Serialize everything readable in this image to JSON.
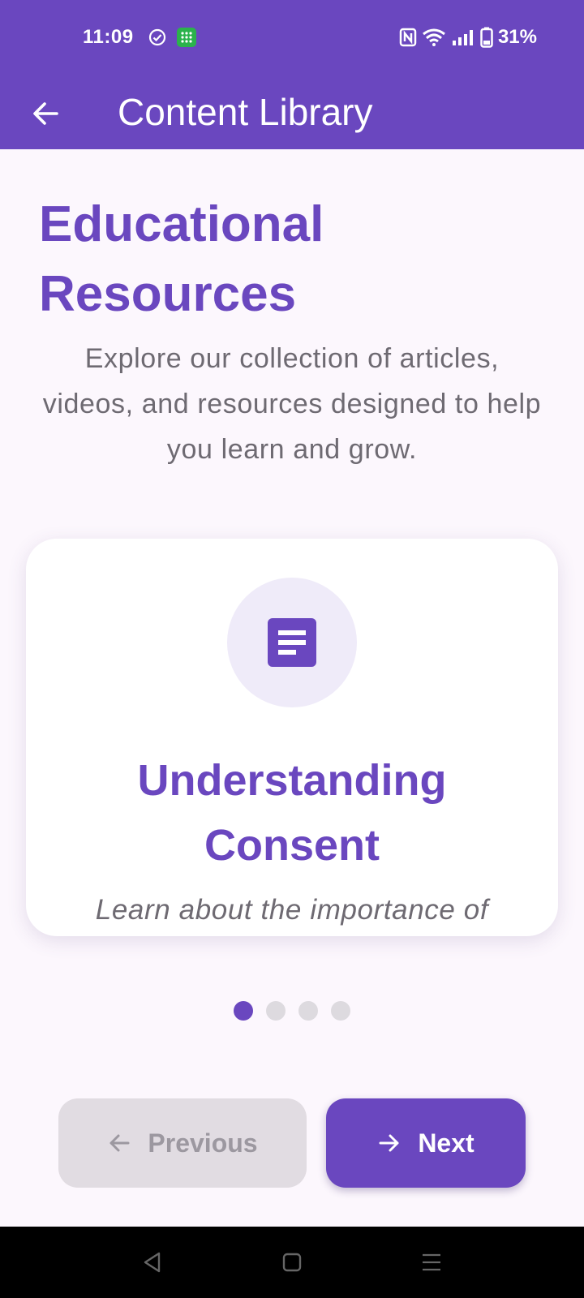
{
  "status_bar": {
    "time": "11:09",
    "battery_text": "31%",
    "icons": [
      "check-circle-icon",
      "app-grid-icon",
      "nfc-icon",
      "wifi-icon",
      "signal-icon",
      "battery-icon"
    ]
  },
  "app_bar": {
    "title": "Content Library",
    "back_icon": "arrow-left-icon",
    "color": "#6A47BF"
  },
  "page": {
    "heading": "Educational Resources",
    "subtitle": "Explore our collection of articles, videos, and resources designed to help you learn and grow."
  },
  "card": {
    "icon": "article-icon",
    "title": "Understanding Consent",
    "description": "Learn about the importance of"
  },
  "pager": {
    "total": 4,
    "current": 1
  },
  "buttons": {
    "previous_label": "Previous",
    "next_label": "Next",
    "previous_enabled": false
  },
  "colors": {
    "accent": "#6A47BF",
    "background": "#FCF7FD",
    "text_muted": "#6E6A72"
  },
  "system_nav": [
    "back-triangle-icon",
    "home-square-icon",
    "menu-lines-icon"
  ]
}
